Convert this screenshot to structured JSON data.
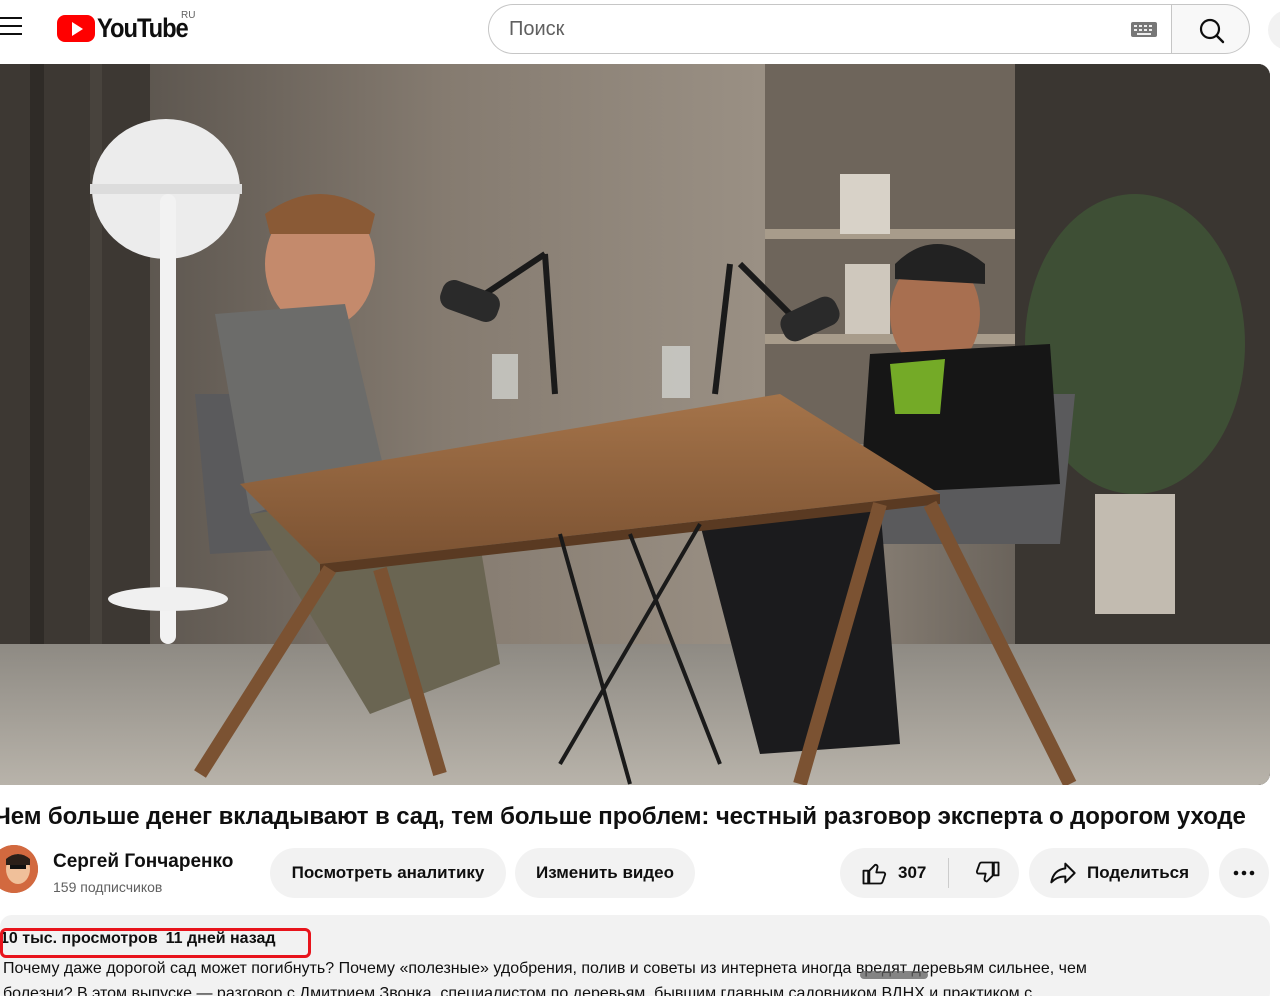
{
  "header": {
    "logo_text": "YouTube",
    "region": "RU",
    "search": {
      "placeholder": "Поиск",
      "value": ""
    }
  },
  "video": {
    "title": "Чем больше денег вкладывают в сад, тем больше проблем: честный разговор эксперта о дорогом уходе",
    "thumbnail_description": "two men talking at a wooden table with microphones"
  },
  "channel": {
    "name": "Сергей Гончаренко",
    "subscribers": "159 подписчиков"
  },
  "actions": {
    "analytics_label": "Посмотреть аналитику",
    "edit_label": "Изменить видео",
    "like_count": "307",
    "share_label": "Поделиться"
  },
  "description": {
    "views": "10 тыс. просмотров",
    "date": "11 дней назад",
    "line1": "Почему даже дорогой сад может погибнуть? Почему «полезные» удобрения, полив и советы из интернета иногда вредят деревьям сильнее, чем",
    "line2": "болезни? В этом выпуске — разговор с Дмитрием Звонка, специалистом по деревьям, бывшим главным садовником ВДНХ и практиком с"
  },
  "colors": {
    "brand_red": "#ff0000",
    "highlight_red": "#e8141c",
    "pill_bg": "#f2f2f2"
  }
}
